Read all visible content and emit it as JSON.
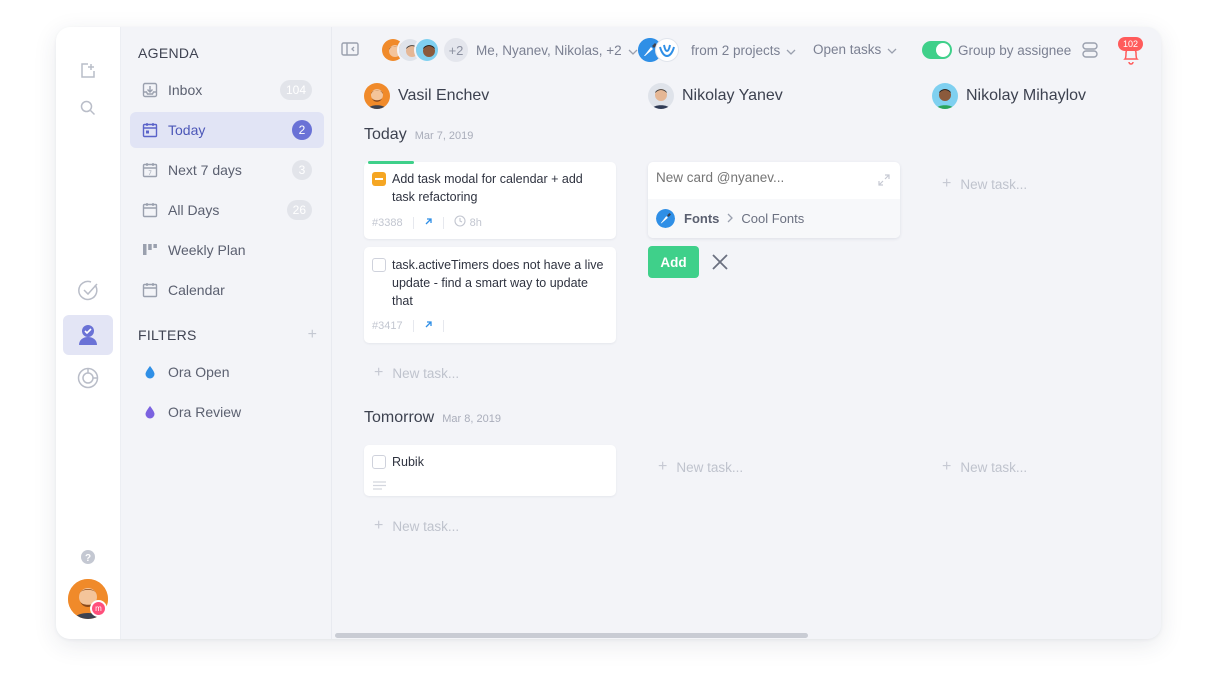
{
  "sidebar": {
    "agenda_title": "AGENDA",
    "filters_title": "FILTERS",
    "items": [
      {
        "label": "Inbox",
        "count": "104",
        "icon": "inbox-icon"
      },
      {
        "label": "Today",
        "count": "2",
        "icon": "calendar-today-icon",
        "active": true
      },
      {
        "label": "Next 7 days",
        "count": "3",
        "icon": "calendar-week-icon"
      },
      {
        "label": "All Days",
        "count": "26",
        "icon": "calendar-icon"
      },
      {
        "label": "Weekly Plan",
        "count": "",
        "icon": "board-icon"
      },
      {
        "label": "Calendar",
        "count": "",
        "icon": "calendar-icon"
      }
    ],
    "filters": [
      {
        "label": "Ora Open",
        "color": "#2f8fe6"
      },
      {
        "label": "Ora Review",
        "color": "#7b62e0"
      }
    ],
    "filter_add": "+"
  },
  "toolbar": {
    "extra_count": "+2",
    "people": "Me, Nyanev, Nikolas, +2",
    "projects": "from 2 projects",
    "tasks_filter": "Open tasks",
    "group_label": "Group by assignee",
    "notif_count": "102"
  },
  "columns": [
    {
      "name": "Vasil Enchev"
    },
    {
      "name": "Nikolay Yanev"
    },
    {
      "name": "Nikolay Mihaylov"
    }
  ],
  "groups": {
    "today": {
      "title": "Today",
      "date": "Mar 7, 2019"
    },
    "tomorrow": {
      "title": "Tomorrow",
      "date": "Mar 8, 2019"
    }
  },
  "cards": [
    {
      "title": "Add task modal for calendar + add task refactoring",
      "id": "#3388",
      "estimate": "8h"
    },
    {
      "title": "task.activeTimers does not have a live update - find a smart way to update that",
      "id": "#3417"
    },
    {
      "title": "Rubik"
    }
  ],
  "new_task": "New task...",
  "new_card": {
    "placeholder": "New card @nyanev...",
    "project": "Fonts",
    "list": "Cool Fonts",
    "add_label": "Add"
  },
  "colors": {
    "accent": "#6a72d6",
    "green": "#3fd08a",
    "notif": "#ff5b5b"
  }
}
